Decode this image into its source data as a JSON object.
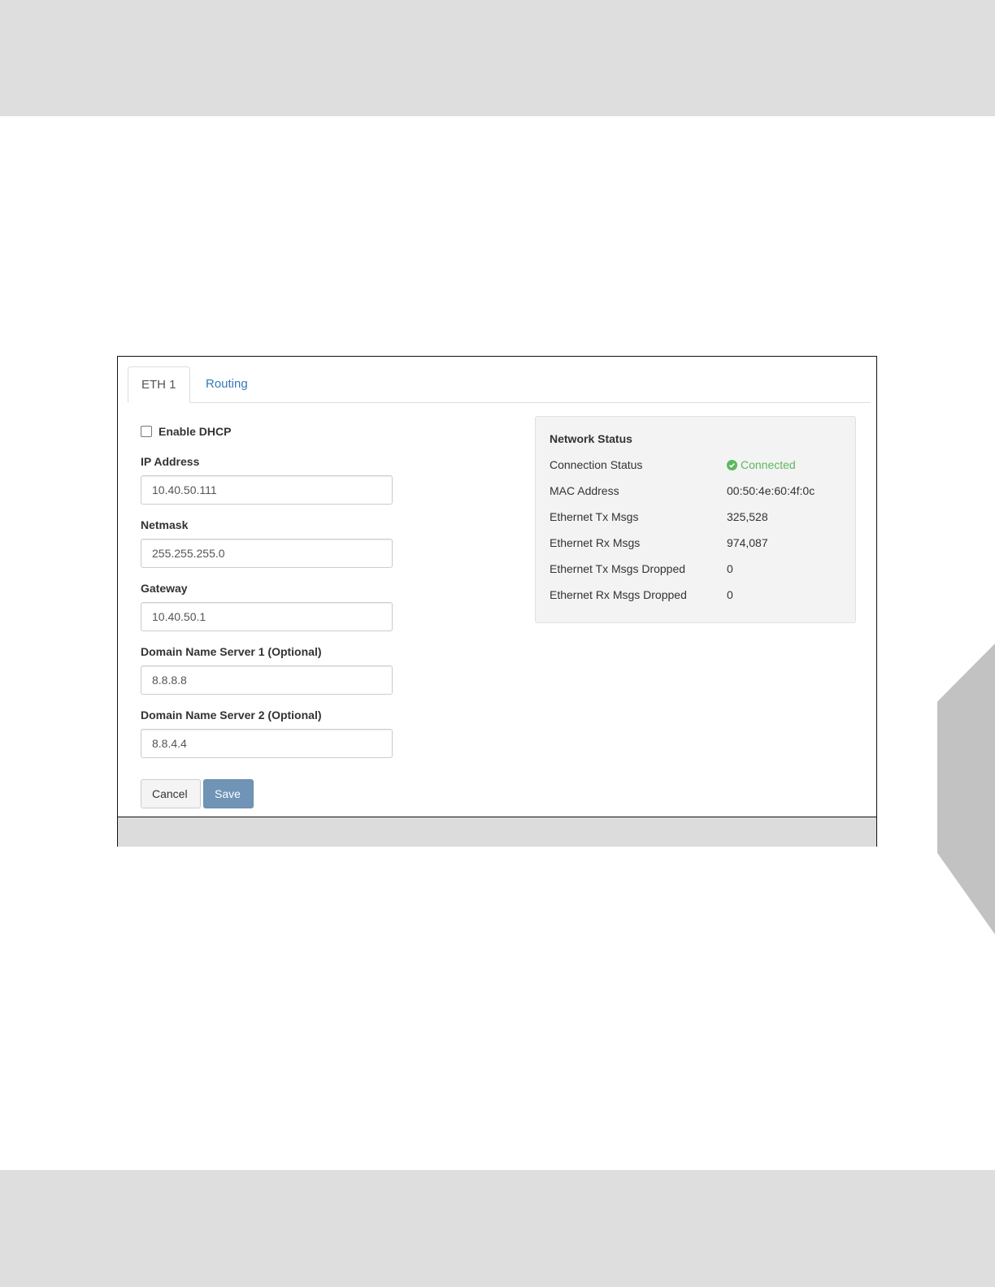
{
  "tabs": [
    {
      "label": "ETH 1",
      "active": true
    },
    {
      "label": "Routing",
      "active": false
    }
  ],
  "form": {
    "dhcp": {
      "label": "Enable DHCP",
      "checked": false
    },
    "ip_address": {
      "label": "IP Address",
      "value": "10.40.50.111"
    },
    "netmask": {
      "label": "Netmask",
      "value": "255.255.255.0"
    },
    "gateway": {
      "label": "Gateway",
      "value": "10.40.50.1"
    },
    "dns1": {
      "label": "Domain Name Server 1 (Optional)",
      "value": "8.8.8.8"
    },
    "dns2": {
      "label": "Domain Name Server 2 (Optional)",
      "value": "8.8.4.4"
    },
    "cancel_label": "Cancel",
    "save_label": "Save"
  },
  "network_status": {
    "title": "Network Status",
    "rows": [
      {
        "key": "Connection Status",
        "value": "Connected"
      },
      {
        "key": "MAC Address",
        "value": "00:50:4e:60:4f:0c"
      },
      {
        "key": "Ethernet Tx Msgs",
        "value": "325,528"
      },
      {
        "key": "Ethernet Rx Msgs",
        "value": "974,087"
      },
      {
        "key": "Ethernet Tx Msgs Dropped",
        "value": "0"
      },
      {
        "key": "Ethernet Rx Msgs Dropped",
        "value": "0"
      }
    ]
  },
  "colors": {
    "link": "#337ab7",
    "save_button": "#6f94b6",
    "connected": "#5cb85c",
    "status_card": "#f3f3f3",
    "page_band": "#dfdedf"
  },
  "icons": {
    "connected_status": "check-circle-icon"
  }
}
